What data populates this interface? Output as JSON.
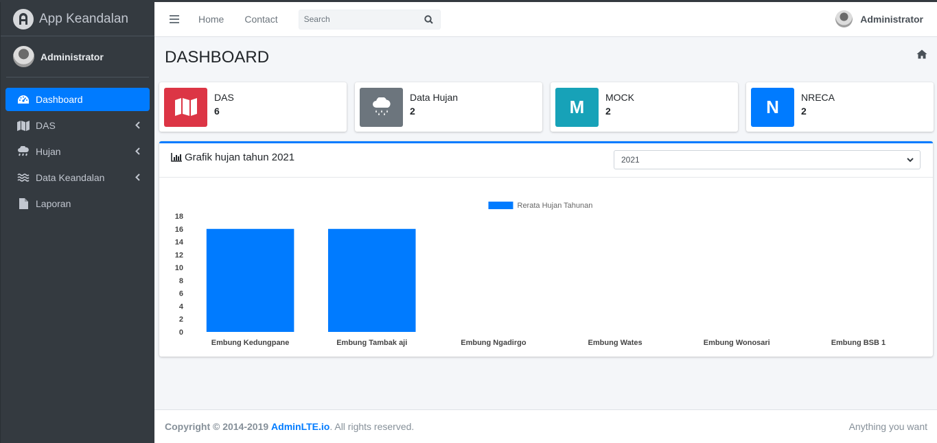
{
  "brand": {
    "name": "App Keandalan"
  },
  "user": {
    "name": "Administrator"
  },
  "sidebar": {
    "items": [
      {
        "label": "Dashboard",
        "icon": "tachometer-icon",
        "active": true,
        "has_arrow": false
      },
      {
        "label": "DAS",
        "icon": "map-icon",
        "active": false,
        "has_arrow": true
      },
      {
        "label": "Hujan",
        "icon": "cloud-rain-icon",
        "active": false,
        "has_arrow": true
      },
      {
        "label": "Data Keandalan",
        "icon": "water-icon",
        "active": false,
        "has_arrow": true
      },
      {
        "label": "Laporan",
        "icon": "file-icon",
        "active": false,
        "has_arrow": false
      }
    ]
  },
  "header": {
    "links": [
      "Home",
      "Contact"
    ],
    "search_placeholder": "Search",
    "user_name": "Administrator"
  },
  "page": {
    "title": "DASHBOARD"
  },
  "info_boxes": [
    {
      "label": "DAS",
      "value": "6",
      "icon": "map-icon",
      "icon_text": "",
      "color": "#dc3545"
    },
    {
      "label": "Data Hujan",
      "value": "2",
      "icon": "cloud-rain-icon",
      "icon_text": "",
      "color": "#6c757d"
    },
    {
      "label": "MOCK",
      "value": "2",
      "icon": "letter-m-icon",
      "icon_text": "M",
      "color": "#17a2b8"
    },
    {
      "label": "NRECA",
      "value": "2",
      "icon": "letter-n-icon",
      "icon_text": "N",
      "color": "#007bff"
    }
  ],
  "chart_card": {
    "title": "Grafik hujan tahun 2021",
    "selected_year": "2021"
  },
  "chart_data": {
    "type": "bar",
    "categories": [
      "Embung Kedungpane",
      "Embung Tambak aji",
      "Embung Ngadirgo",
      "Embung Wates",
      "Embung Wonosari",
      "Embung BSB 1"
    ],
    "series": [
      {
        "name": "Rerata Hujan Tahunan",
        "values": [
          16,
          16,
          0,
          0,
          0,
          0
        ],
        "color": "#007bff"
      }
    ],
    "yticks": [
      0,
      2,
      4,
      6,
      8,
      10,
      12,
      14,
      16,
      18
    ],
    "ylim": [
      0,
      18
    ],
    "legend": "top-center",
    "grid": false
  },
  "footer": {
    "copyright_prefix": "Copyright © 2014-2019 ",
    "brand_link": "AdminLTE.io",
    "suffix": ". All rights reserved.",
    "right_text": "Anything you want"
  }
}
